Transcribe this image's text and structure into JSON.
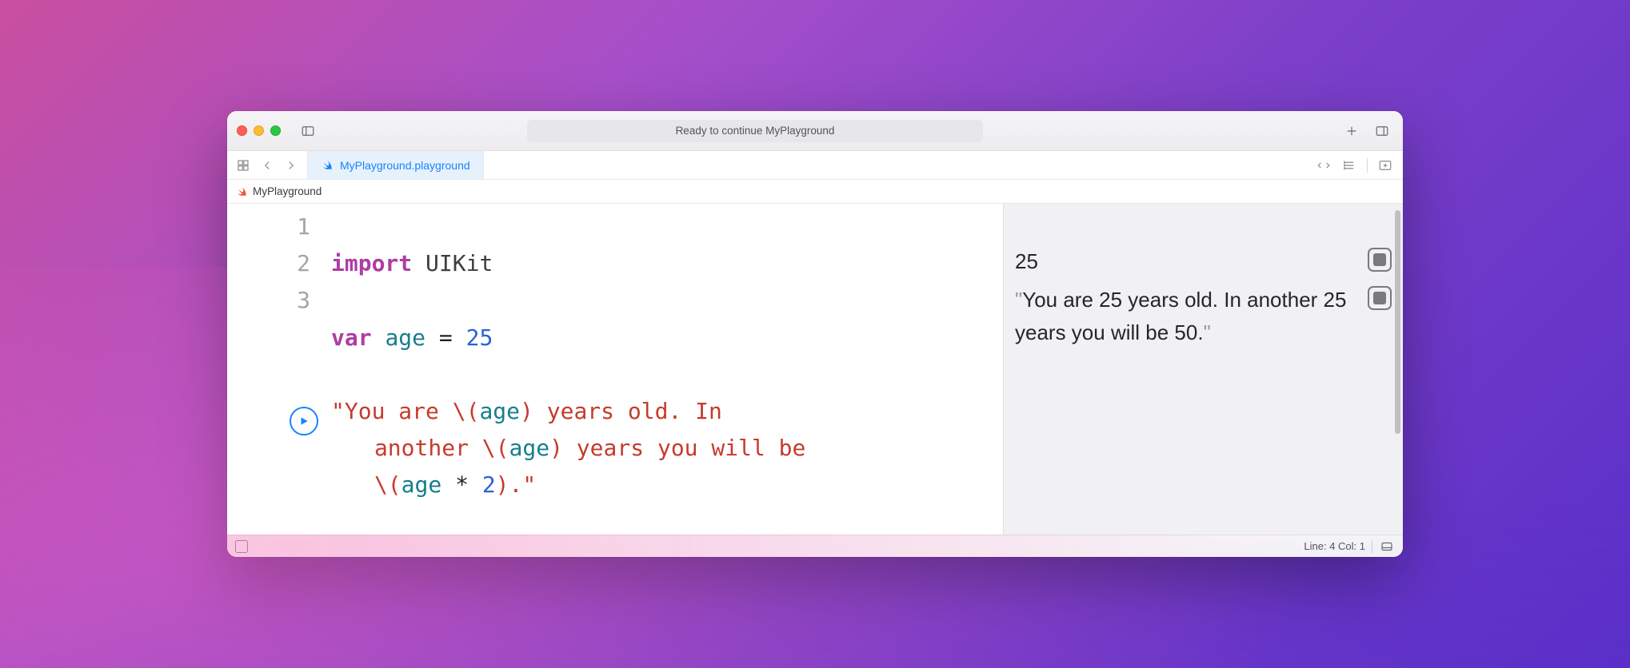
{
  "titlebar": {
    "status_text": "Ready to continue MyPlayground"
  },
  "tab": {
    "label": "MyPlayground.playground"
  },
  "breadcrumb": {
    "label": "MyPlayground"
  },
  "code": {
    "line_numbers": [
      "1",
      "2",
      "3"
    ],
    "line1": {
      "kw": "import",
      "mod": "UIKit"
    },
    "line2": {
      "kw": "var",
      "id": "age",
      "eq": " = ",
      "num": "25"
    },
    "line3": {
      "seg_a": "\"You are ",
      "int1_open": "\\(",
      "int1_id": "age",
      "int1_close": ")",
      "seg_b": " years old. In",
      "seg_c": "another ",
      "int2_open": "\\(",
      "int2_id": "age",
      "int2_close": ")",
      "seg_d": " years you will be",
      "int3_open": "\\(",
      "int3_id": "age",
      "int3_op": " * ",
      "int3_num": "2",
      "int3_close": ")",
      "seg_e": ".\""
    }
  },
  "results": {
    "r1": "25",
    "r2_pre_q": "\"",
    "r2_text": "You are 25 years old. In another 25 years you will be 50.",
    "r2_post_q": "\""
  },
  "statusbar": {
    "cursor": "Line: 4  Col: 1"
  }
}
